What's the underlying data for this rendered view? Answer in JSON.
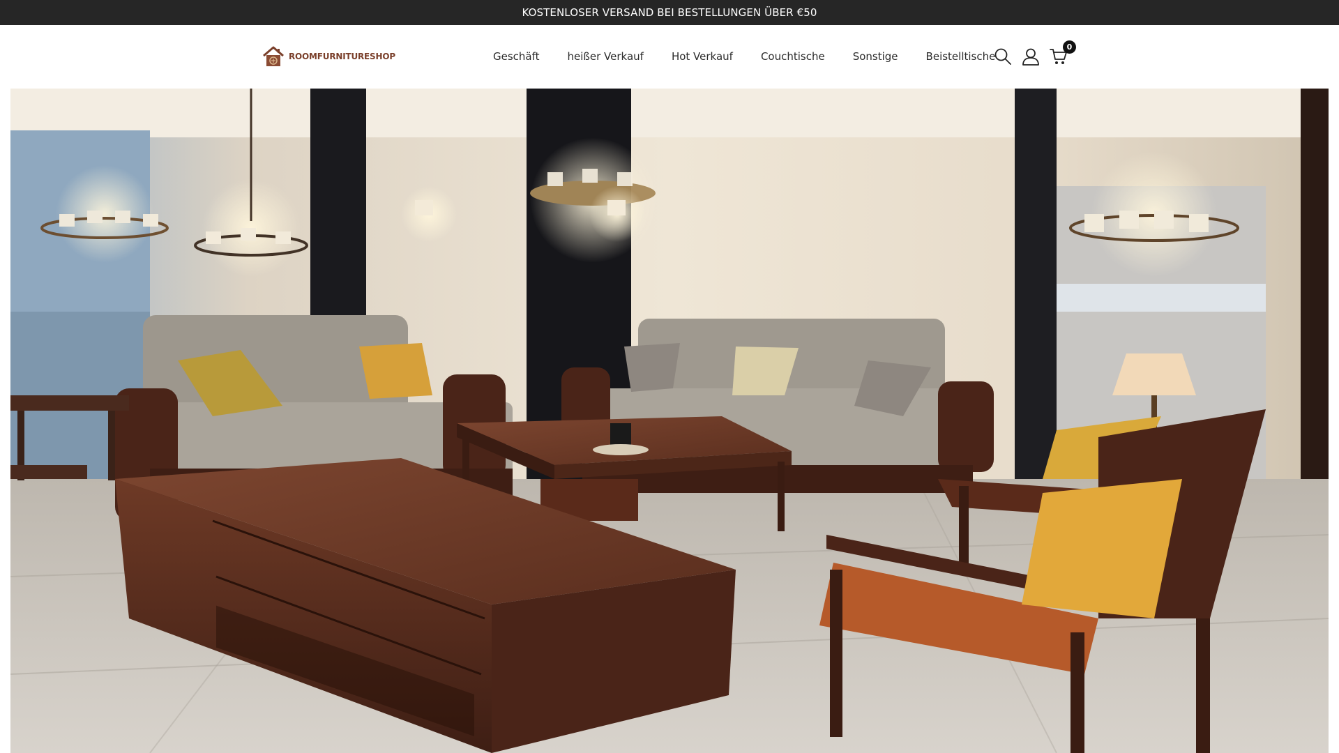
{
  "announcement": {
    "text": "KOSTENLOSER VERSAND BEI BESTELLUNGEN ÜBER €50"
  },
  "header": {
    "logo_text": "ROOMFURNITURESHOP",
    "nav": [
      {
        "label": "Geschäft"
      },
      {
        "label": "heißer Verkauf"
      },
      {
        "label": "Hot Verkauf"
      },
      {
        "label": "Couchtische"
      },
      {
        "label": "Sonstige"
      },
      {
        "label": "Beistelltische"
      }
    ],
    "tools": {
      "search_icon": "search-icon",
      "account_icon": "user-icon",
      "cart_icon": "cart-icon",
      "cart_count": "0"
    }
  },
  "colors": {
    "announcement_bg": "#262626",
    "logo_brown": "#7a3f2a",
    "text": "#2b2b2b"
  }
}
